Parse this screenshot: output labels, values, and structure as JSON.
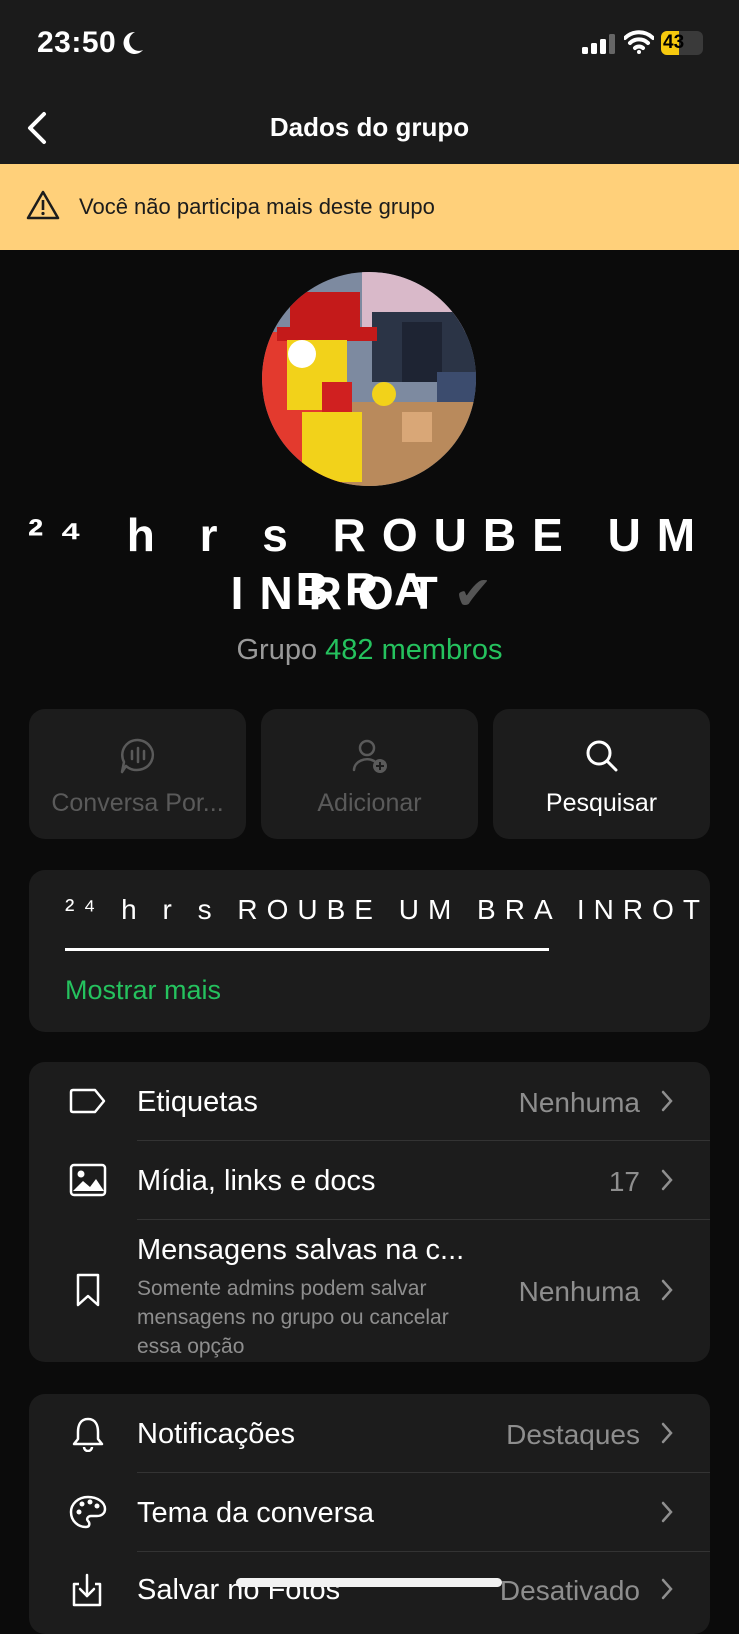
{
  "status_bar": {
    "time": "23:50",
    "battery": "43",
    "battery_level": 0.43,
    "icons": [
      "moon-icon",
      "signal-icon",
      "wifi-icon",
      "battery-charging-icon"
    ]
  },
  "nav": {
    "title": "Dados do grupo",
    "back_icon": "chevron-left-icon"
  },
  "banner": {
    "text": "Você não participa mais deste grupo",
    "icon": "warning-icon",
    "color": "#ffd07a"
  },
  "group": {
    "name_line1": "²⁴ h r s ROUBE UM BRA",
    "name_line2": "INROT",
    "verified_mark": "✔",
    "type_label": "Grupo",
    "members": "482 membros"
  },
  "actions": [
    {
      "label": "Conversa Por...",
      "icon": "voice-chat-icon",
      "enabled": false
    },
    {
      "label": "Adicionar",
      "icon": "add-person-icon",
      "enabled": false
    },
    {
      "label": "Pesquisar",
      "icon": "search-icon",
      "enabled": true
    }
  ],
  "description": {
    "text": "²⁴ h r s ROUBE UM BRA INROT",
    "show_more": "Mostrar mais"
  },
  "section1": [
    {
      "icon": "tag-icon",
      "title": "Etiquetas",
      "value": "Nenhuma"
    },
    {
      "icon": "media-icon",
      "title": "Mídia, links e docs",
      "value": "17"
    },
    {
      "icon": "bookmark-icon",
      "title": "Mensagens salvas na c...",
      "subtitle": "Somente admins podem salvar mensagens no grupo ou cancelar essa opção",
      "value": "Nenhuma"
    }
  ],
  "section2": [
    {
      "icon": "bell-icon",
      "title": "Notificações",
      "value": "Destaques"
    },
    {
      "icon": "palette-icon",
      "title": "Tema da conversa",
      "value": ""
    },
    {
      "icon": "download-icon",
      "title": "Salvar no Fotos",
      "value": "Desativado"
    }
  ],
  "colors": {
    "accent": "#25c25e",
    "background": "#0b0b0b",
    "card": "#1c1c1c"
  }
}
